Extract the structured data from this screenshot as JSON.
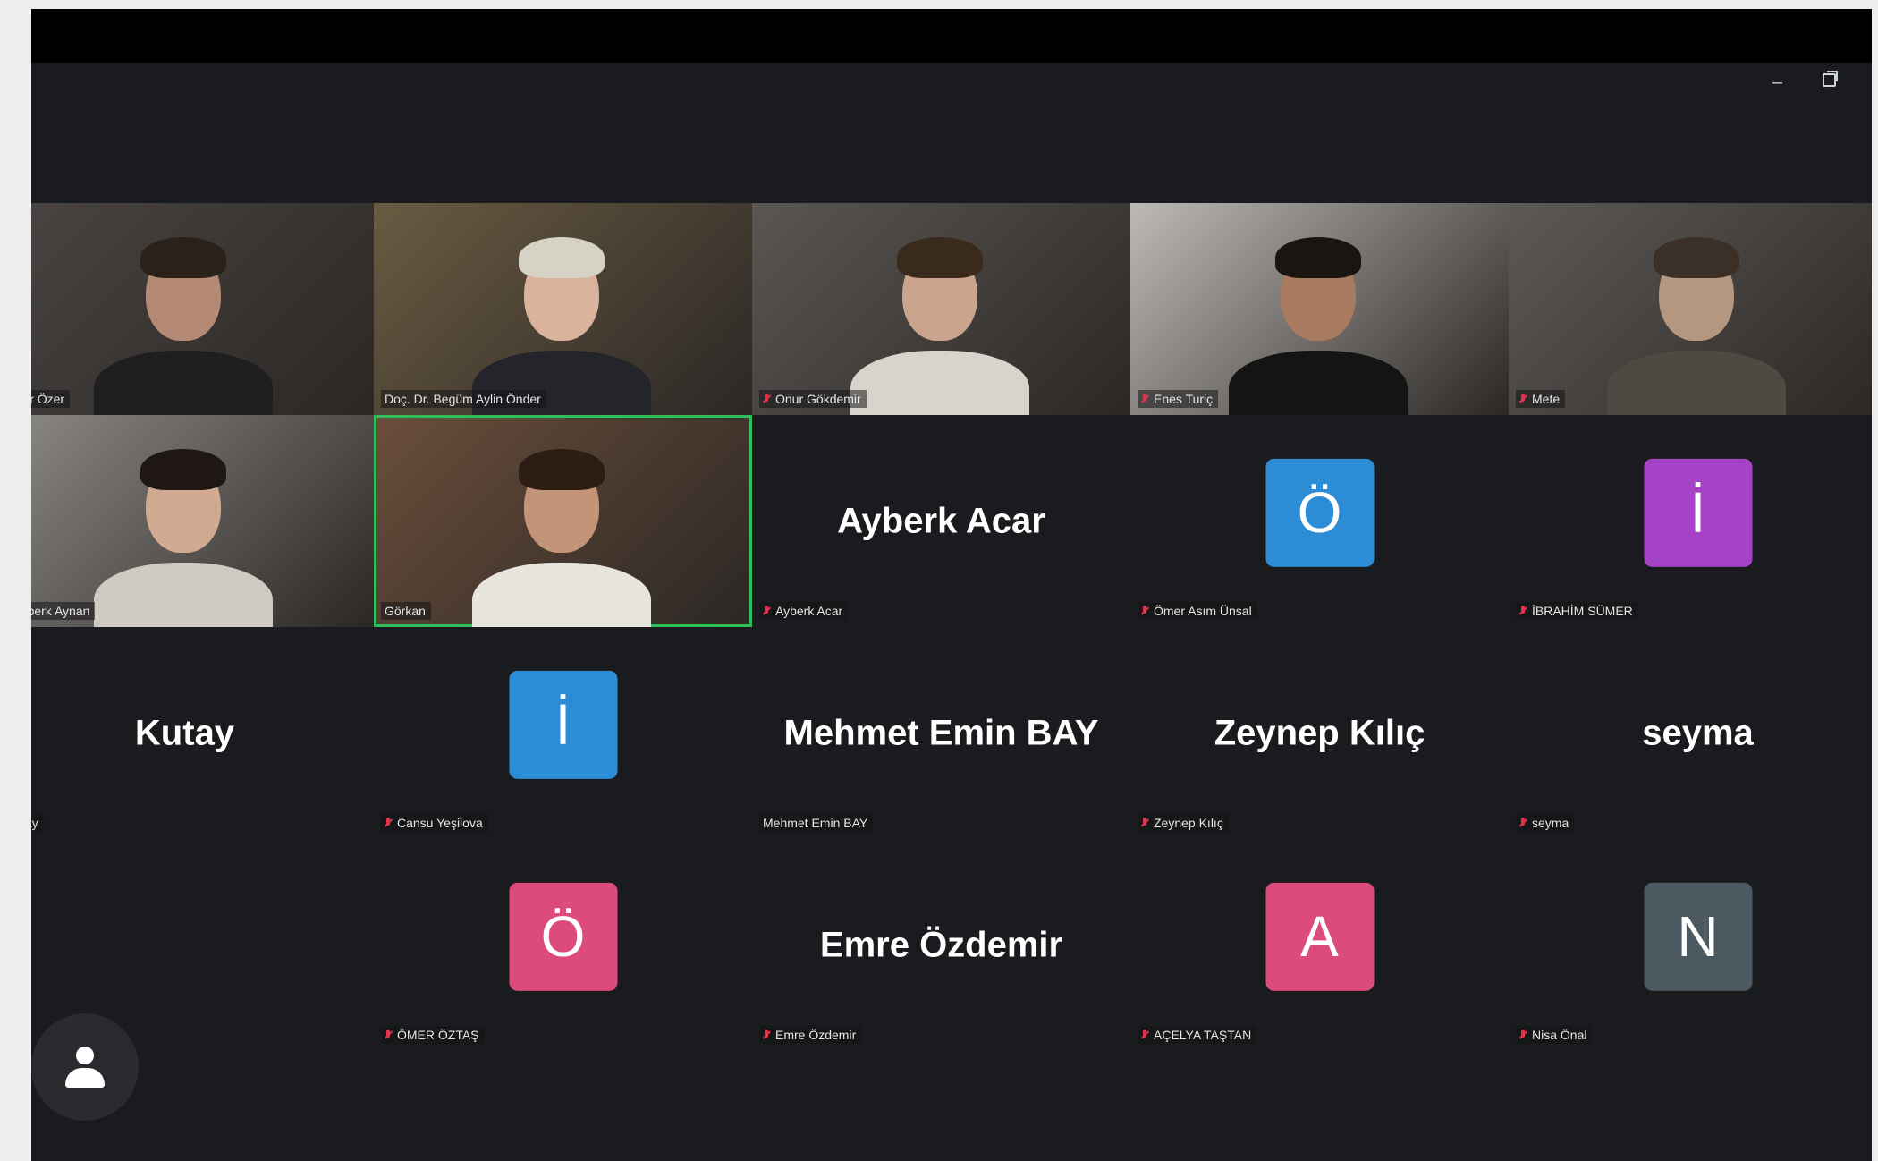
{
  "participants": [
    {
      "display": "video",
      "label": "Yasir Özer",
      "muted": false,
      "colors": {
        "bg": "#4a4542",
        "skin": "#b48a74",
        "hair": "#2a211b",
        "shirt": "#1f1f22"
      }
    },
    {
      "display": "video",
      "label": "Doç. Dr. Begüm Aylin Önder",
      "muted": false,
      "colors": {
        "bg": "#6a5b42",
        "skin": "#d9b39c",
        "hair": "#d6d2c6",
        "shirt": "#23252b"
      }
    },
    {
      "display": "video",
      "label": "Onur Gökdemir",
      "muted": true,
      "colors": {
        "bg": "#5a5653",
        "skin": "#caa48c",
        "hair": "#3a2a1c",
        "shirt": "#d8d4cc"
      }
    },
    {
      "display": "video",
      "label": "Enes Turiç",
      "muted": true,
      "colors": {
        "bg": "#bdbab5",
        "skin": "#a87a60",
        "hair": "#1b1512",
        "shirt": "#141414"
      }
    },
    {
      "display": "video",
      "label": "Mete",
      "muted": true,
      "colors": {
        "bg": "#5d5a56",
        "skin": "#b5967e",
        "hair": "#3b3027",
        "shirt": "#4e4a42"
      }
    },
    {
      "display": "video",
      "label": "Tuğberk Aynan",
      "muted": false,
      "colors": {
        "bg": "#8e8a86",
        "skin": "#d2aa92",
        "hair": "#1e1714",
        "shirt": "#cfcac2"
      }
    },
    {
      "display": "video",
      "label": "Görkan",
      "muted": false,
      "active": true,
      "colors": {
        "bg": "#6b4e3a",
        "skin": "#c49478",
        "hair": "#2b1d14",
        "shirt": "#e8e4de"
      }
    },
    {
      "display": "name",
      "name": "Ayberk Acar",
      "label": "Ayberk Acar",
      "muted": true
    },
    {
      "display": "avatar",
      "letter": "Ö",
      "avatar_color": "#2d8cd6",
      "label": "Ömer Asım Ünsal",
      "muted": true
    },
    {
      "display": "avatar",
      "letter": "İ",
      "avatar_color": "#a642c6",
      "label": "İBRAHİM SÜMER",
      "muted": true
    },
    {
      "display": "name",
      "name": "Kutay",
      "label": "Kutay",
      "muted": false
    },
    {
      "display": "avatar",
      "letter": "İ",
      "avatar_color": "#2d8cd6",
      "label": "Cansu Yeşilova",
      "muted": true
    },
    {
      "display": "name",
      "name": "Mehmet Emin BAY",
      "label": "Mehmet Emin BAY",
      "muted": false
    },
    {
      "display": "name",
      "name": "Zeynep Kılıç",
      "label": "Zeynep Kılıç",
      "muted": true
    },
    {
      "display": "name",
      "name": "seyma",
      "label": "seyma",
      "muted": true
    },
    {
      "display": "empty"
    },
    {
      "display": "avatar",
      "letter": "Ö",
      "avatar_color": "#dd4a7c",
      "label": "ÖMER ÖZTAŞ",
      "muted": true
    },
    {
      "display": "name",
      "name": "Emre Özdemir",
      "label": "Emre Özdemir",
      "muted": true
    },
    {
      "display": "avatar",
      "letter": "A",
      "avatar_color": "#dd4a7c",
      "label": "AÇELYA TAŞTAN",
      "muted": true
    },
    {
      "display": "avatar",
      "letter": "N",
      "avatar_color": "#4d5960",
      "label": "Nisa Önal",
      "muted": true
    }
  ],
  "window_controls": {
    "minimize_glyph": "–"
  },
  "icons": {
    "mic_muted": "mic-off-icon",
    "profile": "person-icon"
  }
}
